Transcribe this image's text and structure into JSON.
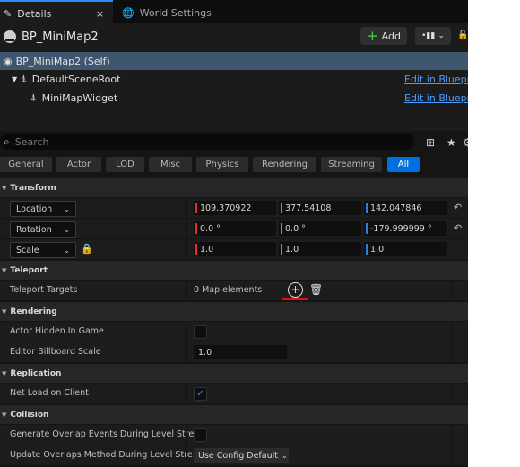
{
  "tabs": [
    {
      "label": "Details",
      "icon": "pencil-icon"
    },
    {
      "label": "World Settings",
      "icon": "globe-icon"
    }
  ],
  "tab_close": "×",
  "header": {
    "title": "BP_MiniMap2",
    "add_label": "Add",
    "add_icon": "plus-icon"
  },
  "tree": [
    {
      "label": "BP_MiniMap2 (Self)"
    },
    {
      "label": "DefaultSceneRoot",
      "link": "Edit in Blueprint"
    },
    {
      "label": "MiniMapWidget",
      "link": "Edit in Blueprint"
    }
  ],
  "search": {
    "placeholder": "Search"
  },
  "filters": [
    "General",
    "Actor",
    "LOD",
    "Misc",
    "Physics",
    "Rendering",
    "Streaming",
    "All"
  ],
  "active_filter": "All",
  "colors": {
    "x": "#e03030",
    "y": "#5fb82c",
    "z": "#2f7fe0",
    "accent": "#0070e0",
    "link": "#4b9cff"
  },
  "transform": {
    "section": "Transform",
    "location": {
      "label": "Location",
      "x": "109.370922",
      "y": "377.54108",
      "z": "142.047846"
    },
    "rotation": {
      "label": "Rotation",
      "x": "0.0 °",
      "y": "0.0 °",
      "z": "-179.999999 °"
    },
    "scale": {
      "label": "Scale",
      "x": "1.0",
      "y": "1.0",
      "z": "1.0"
    }
  },
  "teleport": {
    "section": "Teleport",
    "label": "Teleport Targets",
    "value": "0 Map elements"
  },
  "rendering": {
    "section": "Rendering",
    "hidden_label": "Actor Hidden In Game",
    "hidden_checked": false,
    "billboard_label": "Editor Billboard Scale",
    "billboard_value": "1.0"
  },
  "replication": {
    "section": "Replication",
    "net_label": "Net Load on Client",
    "net_checked": true
  },
  "collision": {
    "section": "Collision",
    "gen_label": "Generate Overlap Events During Level Stre...",
    "gen_checked": false,
    "upd_label": "Update Overlaps Method During Level Stre...",
    "upd_value": "Use Config Default"
  }
}
